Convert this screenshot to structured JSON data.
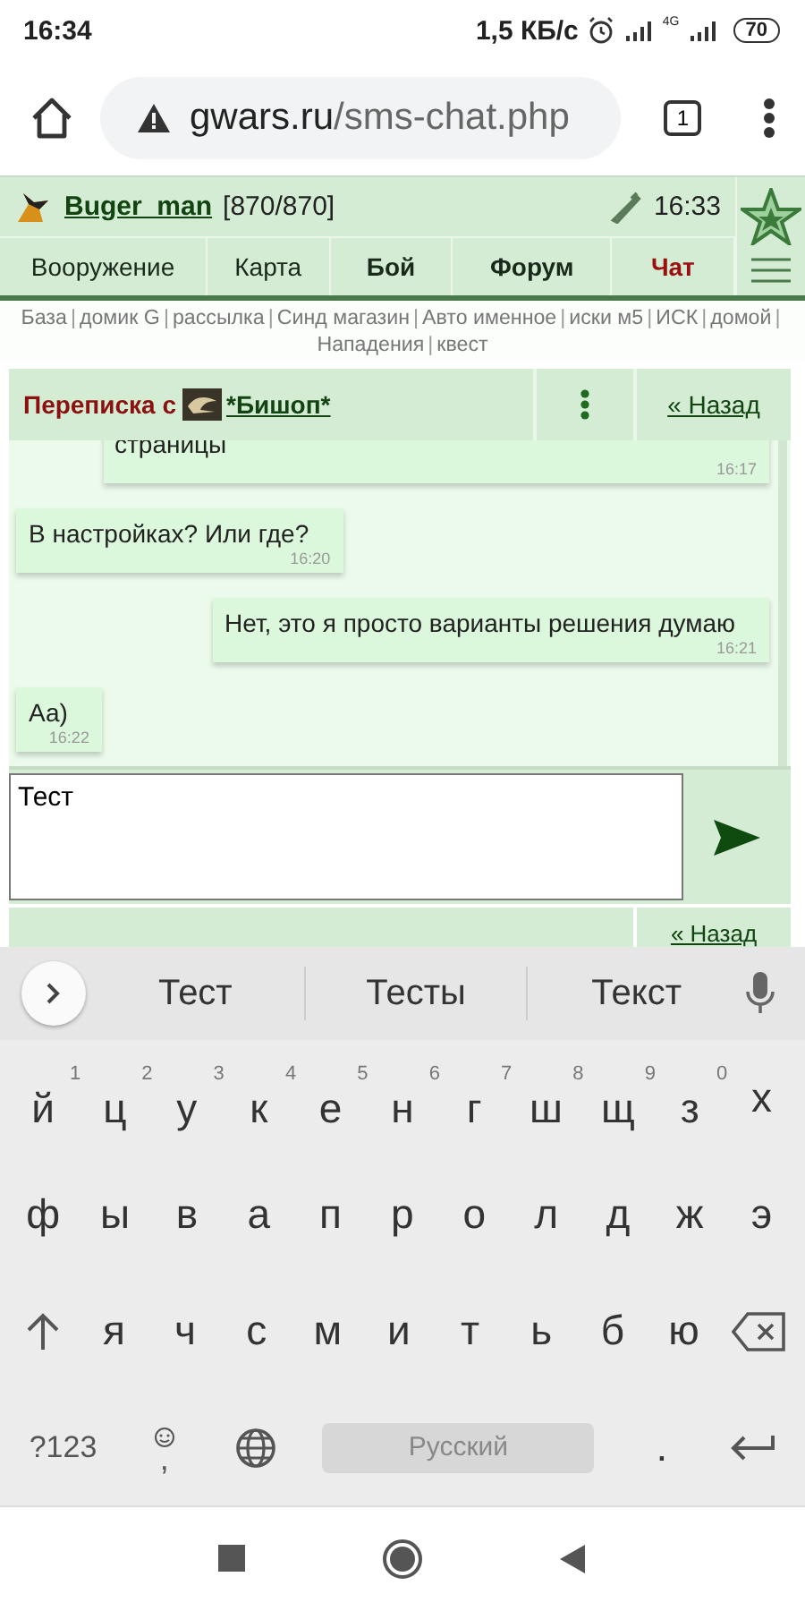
{
  "status_bar": {
    "time": "16:34",
    "speed": "1,5 КБ/с",
    "network": "4G",
    "battery": "70"
  },
  "browser": {
    "url_domain": "gwars.ru",
    "url_path": "/sms-chat.php",
    "tab_count": "1"
  },
  "game_header": {
    "username": "Buger_man",
    "hp": "[870/870]",
    "time": "16:33"
  },
  "nav": [
    {
      "label": "Вооружение",
      "bold": false,
      "selected": false
    },
    {
      "label": "Карта",
      "bold": false,
      "selected": false
    },
    {
      "label": "Бой",
      "bold": true,
      "selected": false
    },
    {
      "label": "Форум",
      "bold": true,
      "selected": false
    },
    {
      "label": "Чат",
      "bold": true,
      "selected": true
    }
  ],
  "links": {
    "separator": "|",
    "items": [
      "База",
      "домик G",
      "рассылка",
      "Синд магазин",
      "Авто именное",
      "иски м5",
      "ИСК",
      "домой",
      "Нападения",
      "квест"
    ]
  },
  "chat_header": {
    "title": "Переписка с",
    "contact": "*Бишоп*",
    "back": "« Назад"
  },
  "messages": [
    {
      "kind": "outgoing",
      "text": "страницы",
      "time": "16:17"
    },
    {
      "kind": "incoming",
      "text": "В настройках? Или где?",
      "time": "16:20"
    },
    {
      "kind": "outgoing",
      "text": "Нет, это я просто варианты решения думаю",
      "time": "16:21"
    },
    {
      "kind": "incoming",
      "text": "Аа)",
      "time": "16:22"
    }
  ],
  "composer": {
    "value": "Тест"
  },
  "bottom_bar": {
    "back": "« Назад"
  },
  "keyboard": {
    "suggestions": [
      "Тест",
      "Тесты",
      "Текст"
    ],
    "rows": [
      [
        {
          "kind": "letter",
          "label": "й",
          "hint": "1"
        },
        {
          "kind": "letter",
          "label": "ц",
          "hint": "2"
        },
        {
          "kind": "letter",
          "label": "у",
          "hint": "3"
        },
        {
          "kind": "letter",
          "label": "к",
          "hint": "4"
        },
        {
          "kind": "letter",
          "label": "е",
          "hint": "5"
        },
        {
          "kind": "letter",
          "label": "н",
          "hint": "6"
        },
        {
          "kind": "letter",
          "label": "г",
          "hint": "7"
        },
        {
          "kind": "letter",
          "label": "ш",
          "hint": "8"
        },
        {
          "kind": "letter",
          "label": "щ",
          "hint": "9"
        },
        {
          "kind": "letter",
          "label": "з",
          "hint": "0"
        },
        {
          "kind": "letter",
          "label": "х"
        }
      ],
      [
        {
          "kind": "letter",
          "label": "ф"
        },
        {
          "kind": "letter",
          "label": "ы"
        },
        {
          "kind": "letter",
          "label": "в"
        },
        {
          "kind": "letter",
          "label": "а"
        },
        {
          "kind": "letter",
          "label": "п"
        },
        {
          "kind": "letter",
          "label": "р"
        },
        {
          "kind": "letter",
          "label": "о"
        },
        {
          "kind": "letter",
          "label": "л"
        },
        {
          "kind": "letter",
          "label": "д"
        },
        {
          "kind": "letter",
          "label": "ж"
        },
        {
          "kind": "letter",
          "label": "э"
        }
      ],
      [
        {
          "kind": "shift"
        },
        {
          "kind": "letter",
          "label": "я"
        },
        {
          "kind": "letter",
          "label": "ч"
        },
        {
          "kind": "letter",
          "label": "с"
        },
        {
          "kind": "letter",
          "label": "м"
        },
        {
          "kind": "letter",
          "label": "и"
        },
        {
          "kind": "letter",
          "label": "т"
        },
        {
          "kind": "letter",
          "label": "ь"
        },
        {
          "kind": "letter",
          "label": "б"
        },
        {
          "kind": "letter",
          "label": "ю"
        },
        {
          "kind": "backspace"
        }
      ]
    ],
    "bottom_row": [
      {
        "kind": "symbols",
        "label": "?123"
      },
      {
        "kind": "emoji",
        "label": ","
      },
      {
        "kind": "globe"
      },
      {
        "kind": "space",
        "label": "Русский"
      },
      {
        "kind": "letter",
        "label": "."
      },
      {
        "kind": "enter"
      }
    ]
  }
}
